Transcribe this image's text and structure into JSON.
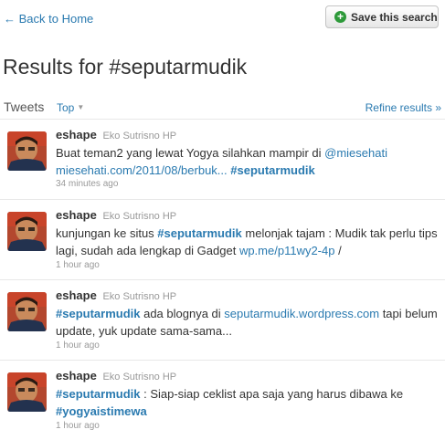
{
  "nav": {
    "back_label": "← Back to Home"
  },
  "actions": {
    "save_search_label": "Save this search",
    "save_icon": "+"
  },
  "title": "Results for #seputarmudik",
  "tabs": {
    "tweets_label": "Tweets",
    "top_label": "Top",
    "refine_label": "Refine results »"
  },
  "colors": {
    "link": "#2a7ab0",
    "save_icon_green": "#2e9a3a",
    "muted_text": "#999999"
  },
  "tweets": [
    {
      "username": "eshape",
      "fullname": "Eko Sutrisno HP",
      "segments": [
        {
          "type": "text",
          "text": "Buat teman2 yang lewat Yogya silahkan mampir di "
        },
        {
          "type": "mention",
          "text": "@miesehati"
        },
        {
          "type": "text",
          "text": " "
        },
        {
          "type": "url",
          "text": "miesehati.com/2011/08/berbuk..."
        },
        {
          "type": "text",
          "text": " "
        },
        {
          "type": "hashtag",
          "text": "#seputarmudik"
        }
      ],
      "timestamp": "34 minutes ago"
    },
    {
      "username": "eshape",
      "fullname": "Eko Sutrisno HP",
      "segments": [
        {
          "type": "text",
          "text": "kunjungan ke situs "
        },
        {
          "type": "hashtag",
          "text": "#seputarmudik"
        },
        {
          "type": "text",
          "text": " melonjak tajam : Mudik tak perlu tips lagi, sudah ada lengkap di Gadget "
        },
        {
          "type": "url",
          "text": "wp.me/p11wy2-4p"
        },
        {
          "type": "text",
          "text": " /"
        }
      ],
      "timestamp": "1 hour ago"
    },
    {
      "username": "eshape",
      "fullname": "Eko Sutrisno HP",
      "segments": [
        {
          "type": "hashtag",
          "text": "#seputarmudik"
        },
        {
          "type": "text",
          "text": " ada blognya di "
        },
        {
          "type": "url",
          "text": "seputarmudik.wordpress.com"
        },
        {
          "type": "text",
          "text": " tapi belum update, yuk update sama-sama..."
        }
      ],
      "timestamp": "1 hour ago"
    },
    {
      "username": "eshape",
      "fullname": "Eko Sutrisno HP",
      "segments": [
        {
          "type": "hashtag",
          "text": "#seputarmudik"
        },
        {
          "type": "text",
          "text": " : Siap-siap ceklist apa saja yang harus dibawa ke "
        },
        {
          "type": "hashtag",
          "text": "#yogyaistimewa"
        }
      ],
      "timestamp": "1 hour ago"
    }
  ]
}
